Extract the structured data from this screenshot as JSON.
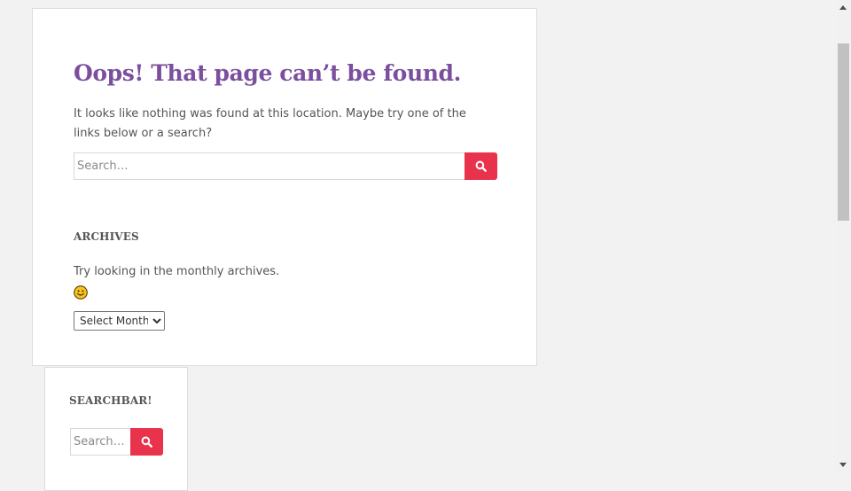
{
  "main": {
    "title": "Oops! That page can’t be found.",
    "lead": "It looks like nothing was found at this location. Maybe try one of the links below or a search?",
    "search": {
      "placeholder": "Search…",
      "value": ""
    },
    "archives": {
      "title": "ARCHIVES",
      "text": "Try looking in the monthly archives.",
      "emoji": "smiley-face",
      "select_value": "Select Month"
    }
  },
  "sidebar_widget": {
    "title": "SEARCHBAR!",
    "search": {
      "placeholder": "Search…",
      "value": ""
    }
  },
  "colors": {
    "accent": "#e9334c",
    "title": "#7b4f9e",
    "page_bg": "#f2f2f2",
    "text": "#555555"
  },
  "icons": {
    "search_button": "search-icon",
    "scroll_up": "scroll-up-arrow-icon",
    "scroll_down": "scroll-down-arrow-icon"
  }
}
